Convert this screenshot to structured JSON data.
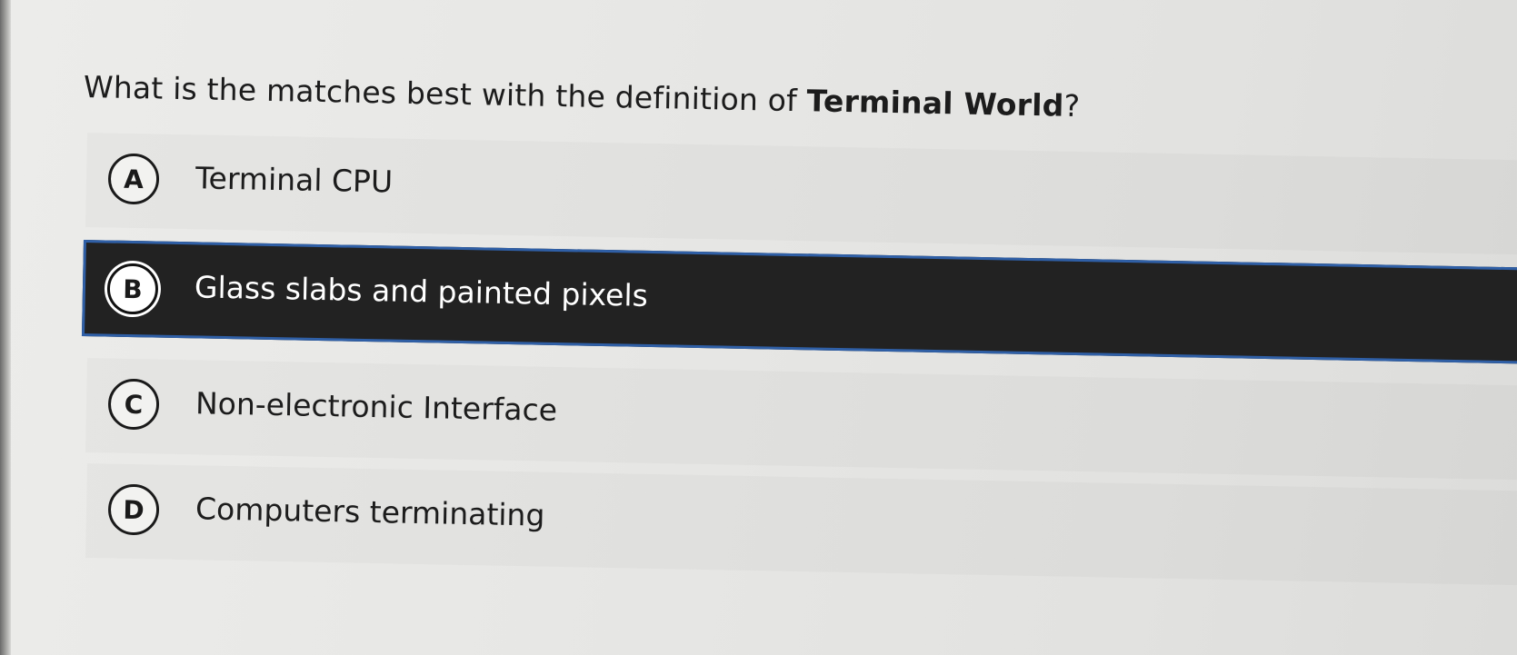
{
  "question": {
    "prefix": "What is the matches best with the definition of ",
    "term": "Terminal World",
    "suffix": "?"
  },
  "options": [
    {
      "letter": "A",
      "label": "Terminal CPU",
      "selected": false
    },
    {
      "letter": "B",
      "label": "Glass slabs and painted pixels",
      "selected": true
    },
    {
      "letter": "C",
      "label": "Non-electronic Interface",
      "selected": false
    },
    {
      "letter": "D",
      "label": "Computers terminating",
      "selected": false
    }
  ],
  "colors": {
    "selected_background": "#222222",
    "selected_border": "#2f5fa6",
    "page_background": "#e7e7e5"
  }
}
